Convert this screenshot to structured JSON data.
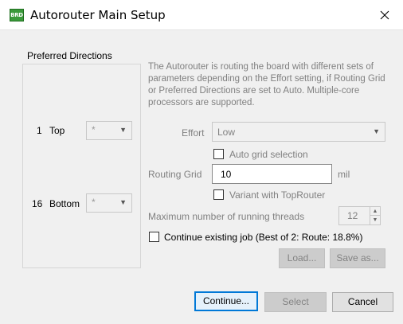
{
  "window": {
    "icon_text": "BRD",
    "title": "Autorouter Main Setup",
    "close_glyph": "✕"
  },
  "preferred_directions": {
    "group_label": "Preferred Directions",
    "layers": [
      {
        "number": "1",
        "name": "Top",
        "value": "*"
      },
      {
        "number": "16",
        "name": "Bottom",
        "value": "*"
      }
    ]
  },
  "description": "The Autorouter is routing the board with different sets of parameters depending on the Effort setting, if Routing Grid or Preferred Directions are set to Auto. Multiple-core processors are supported.",
  "effort": {
    "label": "Effort",
    "value": "Low"
  },
  "auto_grid": {
    "label": "Auto grid selection",
    "checked": false
  },
  "routing_grid": {
    "label": "Routing Grid",
    "value": "10",
    "unit": "mil"
  },
  "variant_toprouter": {
    "label": "Variant with TopRouter",
    "checked": false
  },
  "threads": {
    "label": "Maximum number of running threads",
    "value": "12"
  },
  "continue_job": {
    "label": "Continue existing job (Best of 2: Route: 18.8%)",
    "checked": false
  },
  "buttons": {
    "load": "Load...",
    "save_as": "Save as...",
    "continue": "Continue...",
    "select": "Select",
    "cancel": "Cancel"
  },
  "icons": {
    "dropdown": "chevron-down-icon",
    "spin_up": "spin-up-icon",
    "spin_down": "spin-down-icon",
    "close": "close-icon",
    "app": "brd-app-icon"
  },
  "colors": {
    "default_button_border": "#0078d7",
    "app_icon": "#3a9a3a",
    "disabled_text": "#808080"
  }
}
